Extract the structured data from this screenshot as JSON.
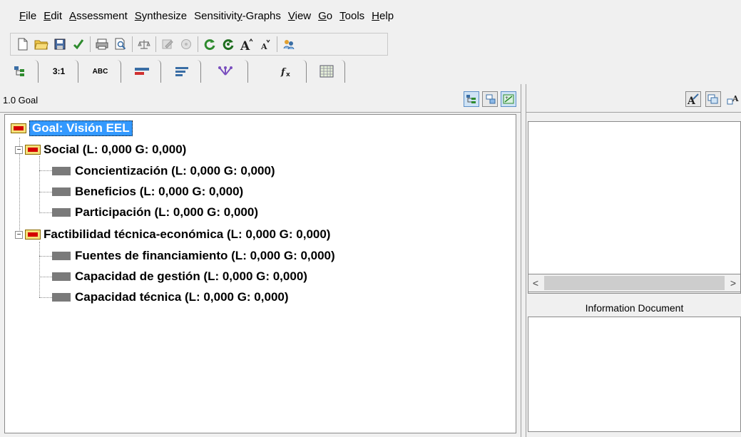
{
  "menu": [
    {
      "accel": "F",
      "rest": "ile"
    },
    {
      "accel": "E",
      "rest": "dit"
    },
    {
      "accel": "A",
      "rest": "ssessment"
    },
    {
      "accel": "S",
      "rest": "ynthesize"
    },
    {
      "pre": "Sensitivit",
      "accel": "y",
      "rest": "-Graphs"
    },
    {
      "accel": "V",
      "rest": "iew"
    },
    {
      "accel": "G",
      "rest": "o"
    },
    {
      "accel": "T",
      "rest": "ools"
    },
    {
      "accel": "H",
      "rest": "elp"
    }
  ],
  "tabs": [
    {
      "label": "",
      "icon": "tree-view-icon"
    },
    {
      "label": "3:1",
      "icon": ""
    },
    {
      "label": "ABC",
      "icon": ""
    },
    {
      "label": "",
      "icon": "bar-chart-icon"
    },
    {
      "label": "",
      "icon": "list-lines-icon"
    },
    {
      "label": "",
      "icon": "network-icon"
    },
    {
      "label": "",
      "icon": "formula-icon"
    },
    {
      "label": "",
      "icon": "grid-icon"
    }
  ],
  "left_panel": {
    "header_title": "1.0 Goal"
  },
  "tree": {
    "goal": "Goal: Visión EEL",
    "nodes": [
      {
        "label": "Social (L: 0,000 G: 0,000)"
      },
      {
        "label": "Concientización (L: 0,000 G: 0,000)"
      },
      {
        "label": "Beneficios (L: 0,000 G: 0,000)"
      },
      {
        "label": "Participación (L: 0,000 G: 0,000)"
      },
      {
        "label": "Factibilidad técnica-económica (L: 0,000 G: 0,000)"
      },
      {
        "label": "Fuentes de financiamiento (L: 0,000 G: 0,000)"
      },
      {
        "label": "Capacidad de gestión (L: 0,000 G: 0,000)"
      },
      {
        "label": "Capacidad técnica (L: 0,000 G: 0,000)"
      }
    ]
  },
  "right_panel": {
    "info_label": "Information Document",
    "scroll_left": "<",
    "scroll_right": ">"
  },
  "colors": {
    "selection": "#3399ff",
    "goal_icon_fill": "#f5e07a",
    "goal_icon_bar": "#d40000",
    "leaf_icon": "#7a7a7a"
  }
}
